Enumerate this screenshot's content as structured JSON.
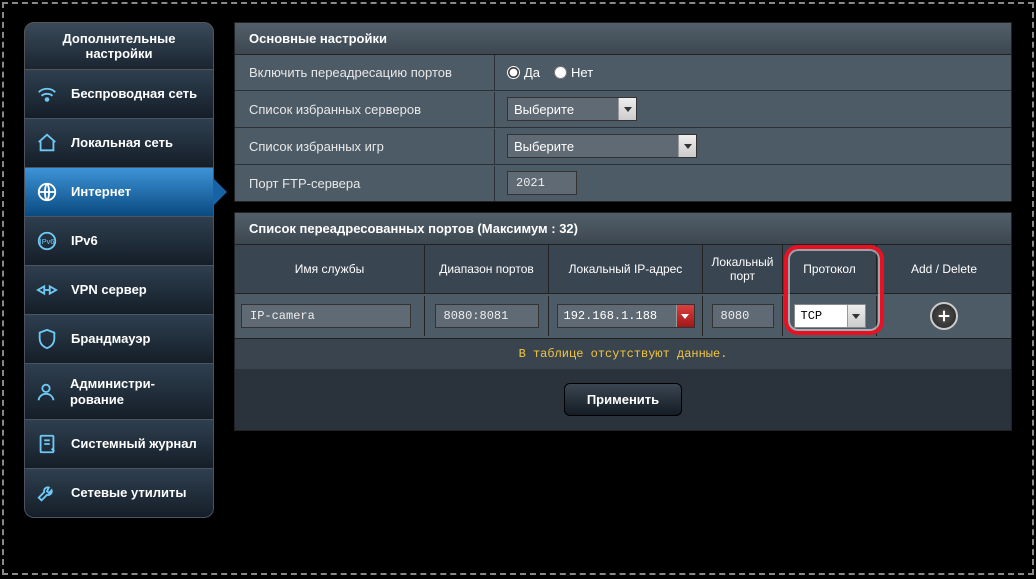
{
  "sidebar": {
    "title": "Дополнительные настройки",
    "items": [
      {
        "label": "Беспроводная сеть",
        "icon": "wifi"
      },
      {
        "label": "Локальная сеть",
        "icon": "home"
      },
      {
        "label": "Интернет",
        "icon": "globe"
      },
      {
        "label": "IPv6",
        "icon": "ipv6"
      },
      {
        "label": "VPN сервер",
        "icon": "vpn"
      },
      {
        "label": "Брандмауэр",
        "icon": "shield"
      },
      {
        "label": "Администри-рование",
        "icon": "user"
      },
      {
        "label": "Системный журнал",
        "icon": "log"
      },
      {
        "label": "Сетевые утилиты",
        "icon": "wrench"
      }
    ]
  },
  "basic": {
    "title": "Основные настройки",
    "enable_label": "Включить переадресацию портов",
    "yes": "Да",
    "no": "Нет",
    "enabled_value": "yes",
    "fav_servers_label": "Список избранных серверов",
    "fav_servers_value": "Выберите",
    "fav_games_label": "Список избранных игр",
    "fav_games_value": "Выберите",
    "ftp_label": "Порт FTP-сервера",
    "ftp_value": "2021"
  },
  "portlist": {
    "title": "Список переадресованных портов (Максимум : 32)",
    "headers": {
      "name": "Имя службы",
      "range": "Диапазон портов",
      "ip": "Локальный IP-адрес",
      "port": "Локальный порт",
      "proto": "Протокол",
      "action": "Add / Delete"
    },
    "row": {
      "name": "IP-camera",
      "range": "8080:8081",
      "ip": "192.168.1.188",
      "port": "8080",
      "proto": "TCP"
    },
    "empty_msg": "В таблице отсутствуют данные."
  },
  "apply_label": "Применить"
}
